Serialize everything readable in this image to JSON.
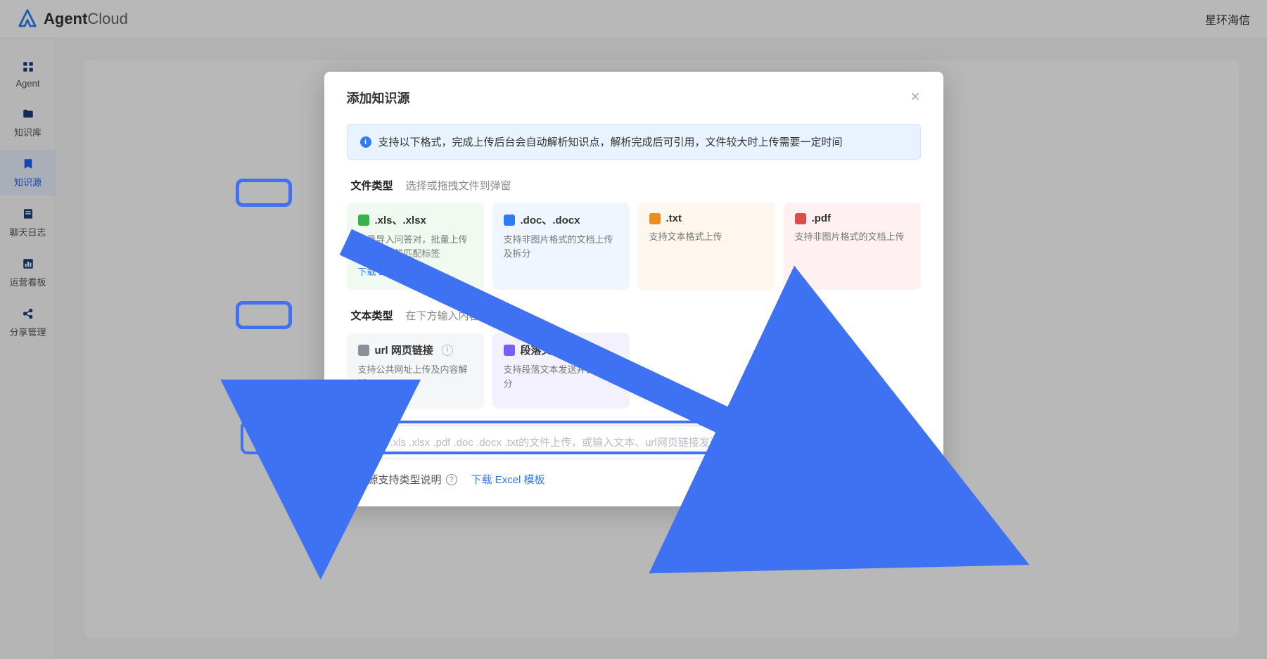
{
  "header": {
    "brand_bold": "Agent",
    "brand_light": "Cloud",
    "user": "星环海信"
  },
  "sidebar": {
    "items": [
      {
        "label": "Agent",
        "icon": "grid-icon"
      },
      {
        "label": "知识库",
        "icon": "folder-icon"
      },
      {
        "label": "知识源",
        "icon": "bookmark-icon"
      },
      {
        "label": "聊天日志",
        "icon": "log-icon"
      },
      {
        "label": "运营看板",
        "icon": "chart-icon"
      },
      {
        "label": "分享管理",
        "icon": "share-icon"
      }
    ],
    "active_index": 2
  },
  "modal": {
    "title": "添加知识源",
    "banner": "支持以下格式，完成上传后台会自动解析知识点，解析完成后可引用，文件较大时上传需要一定时间",
    "file_section": {
      "label": "文件类型",
      "sub": "选择或拖拽文件到弹窗",
      "cards": [
        {
          "bg": "bg-green",
          "ic": "ic-green",
          "title": ".xls、.xlsx",
          "desc": "批量导入问答对，批量上传图片、问答匹配标签",
          "link": "下载 Excel 模板"
        },
        {
          "bg": "bg-blue",
          "ic": "ic-blue",
          "title": ".doc、.docx",
          "desc": "支持非图片格式的文档上传及拆分"
        },
        {
          "bg": "bg-orange",
          "ic": "ic-orange",
          "title": ".txt",
          "desc": "支持文本格式上传"
        },
        {
          "bg": "bg-red",
          "ic": "ic-red",
          "title": ".pdf",
          "desc": "支持非图片格式的文档上传"
        }
      ]
    },
    "text_section": {
      "label": "文本类型",
      "sub": "在下方输入内容发送",
      "cards": [
        {
          "bg": "bg-gray",
          "ic": "ic-gray",
          "title": "url 网页链接",
          "desc": "支持公共网址上传及内容解析",
          "has_info": true
        },
        {
          "bg": "bg-purple",
          "ic": "ic-purple",
          "title": "段落文本",
          "desc": "支持段落文本发送并自动拆分"
        }
      ]
    },
    "input_placeholder": "请选择.xls .xlsx .pdf .doc .docx .txt的文件上传，或输入文本、url网页链接发送",
    "bottom": {
      "support_label": "知识源支持类型说明",
      "download_link": "下载 Excel 模板"
    }
  }
}
